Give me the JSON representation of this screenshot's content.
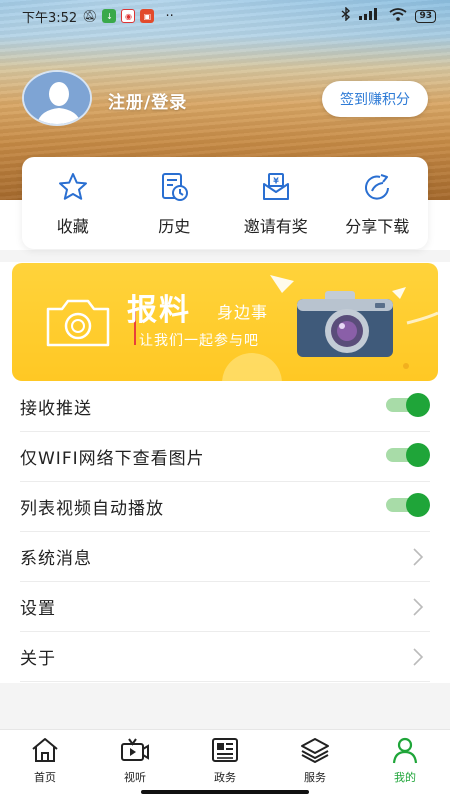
{
  "status_bar": {
    "time": "下午3:52",
    "battery": "93"
  },
  "user": {
    "login_label": "注册/登录",
    "checkin_button": "签到赚积分"
  },
  "quick_actions": [
    {
      "label": "收藏",
      "icon": "star-icon"
    },
    {
      "label": "历史",
      "icon": "history-icon"
    },
    {
      "label": "邀请有奖",
      "icon": "invite-reward-icon"
    },
    {
      "label": "分享下载",
      "icon": "share-icon"
    }
  ],
  "banner": {
    "title": "报料",
    "title_suffix": "身边事",
    "subtitle": "让我们一起参与吧"
  },
  "settings": [
    {
      "label": "接收推送",
      "control": "toggle",
      "on": true
    },
    {
      "label": "仅WIFI网络下查看图片",
      "control": "toggle",
      "on": true
    },
    {
      "label": "列表视频自动播放",
      "control": "toggle",
      "on": true
    },
    {
      "label": "系统消息",
      "control": "chevron"
    },
    {
      "label": "设置",
      "control": "chevron"
    },
    {
      "label": "关于",
      "control": "chevron"
    }
  ],
  "nav": [
    {
      "label": "首页",
      "icon": "home-icon"
    },
    {
      "label": "视听",
      "icon": "tv-icon"
    },
    {
      "label": "政务",
      "icon": "newspaper-icon"
    },
    {
      "label": "服务",
      "icon": "layers-icon"
    },
    {
      "label": "我的",
      "icon": "user-icon",
      "active": true
    }
  ],
  "colors": {
    "accent_green": "#1fa539",
    "banner_yellow": "#ffd33b",
    "checkin_blue": "#2e7bd6",
    "icon_blue": "#2a6fd1"
  }
}
